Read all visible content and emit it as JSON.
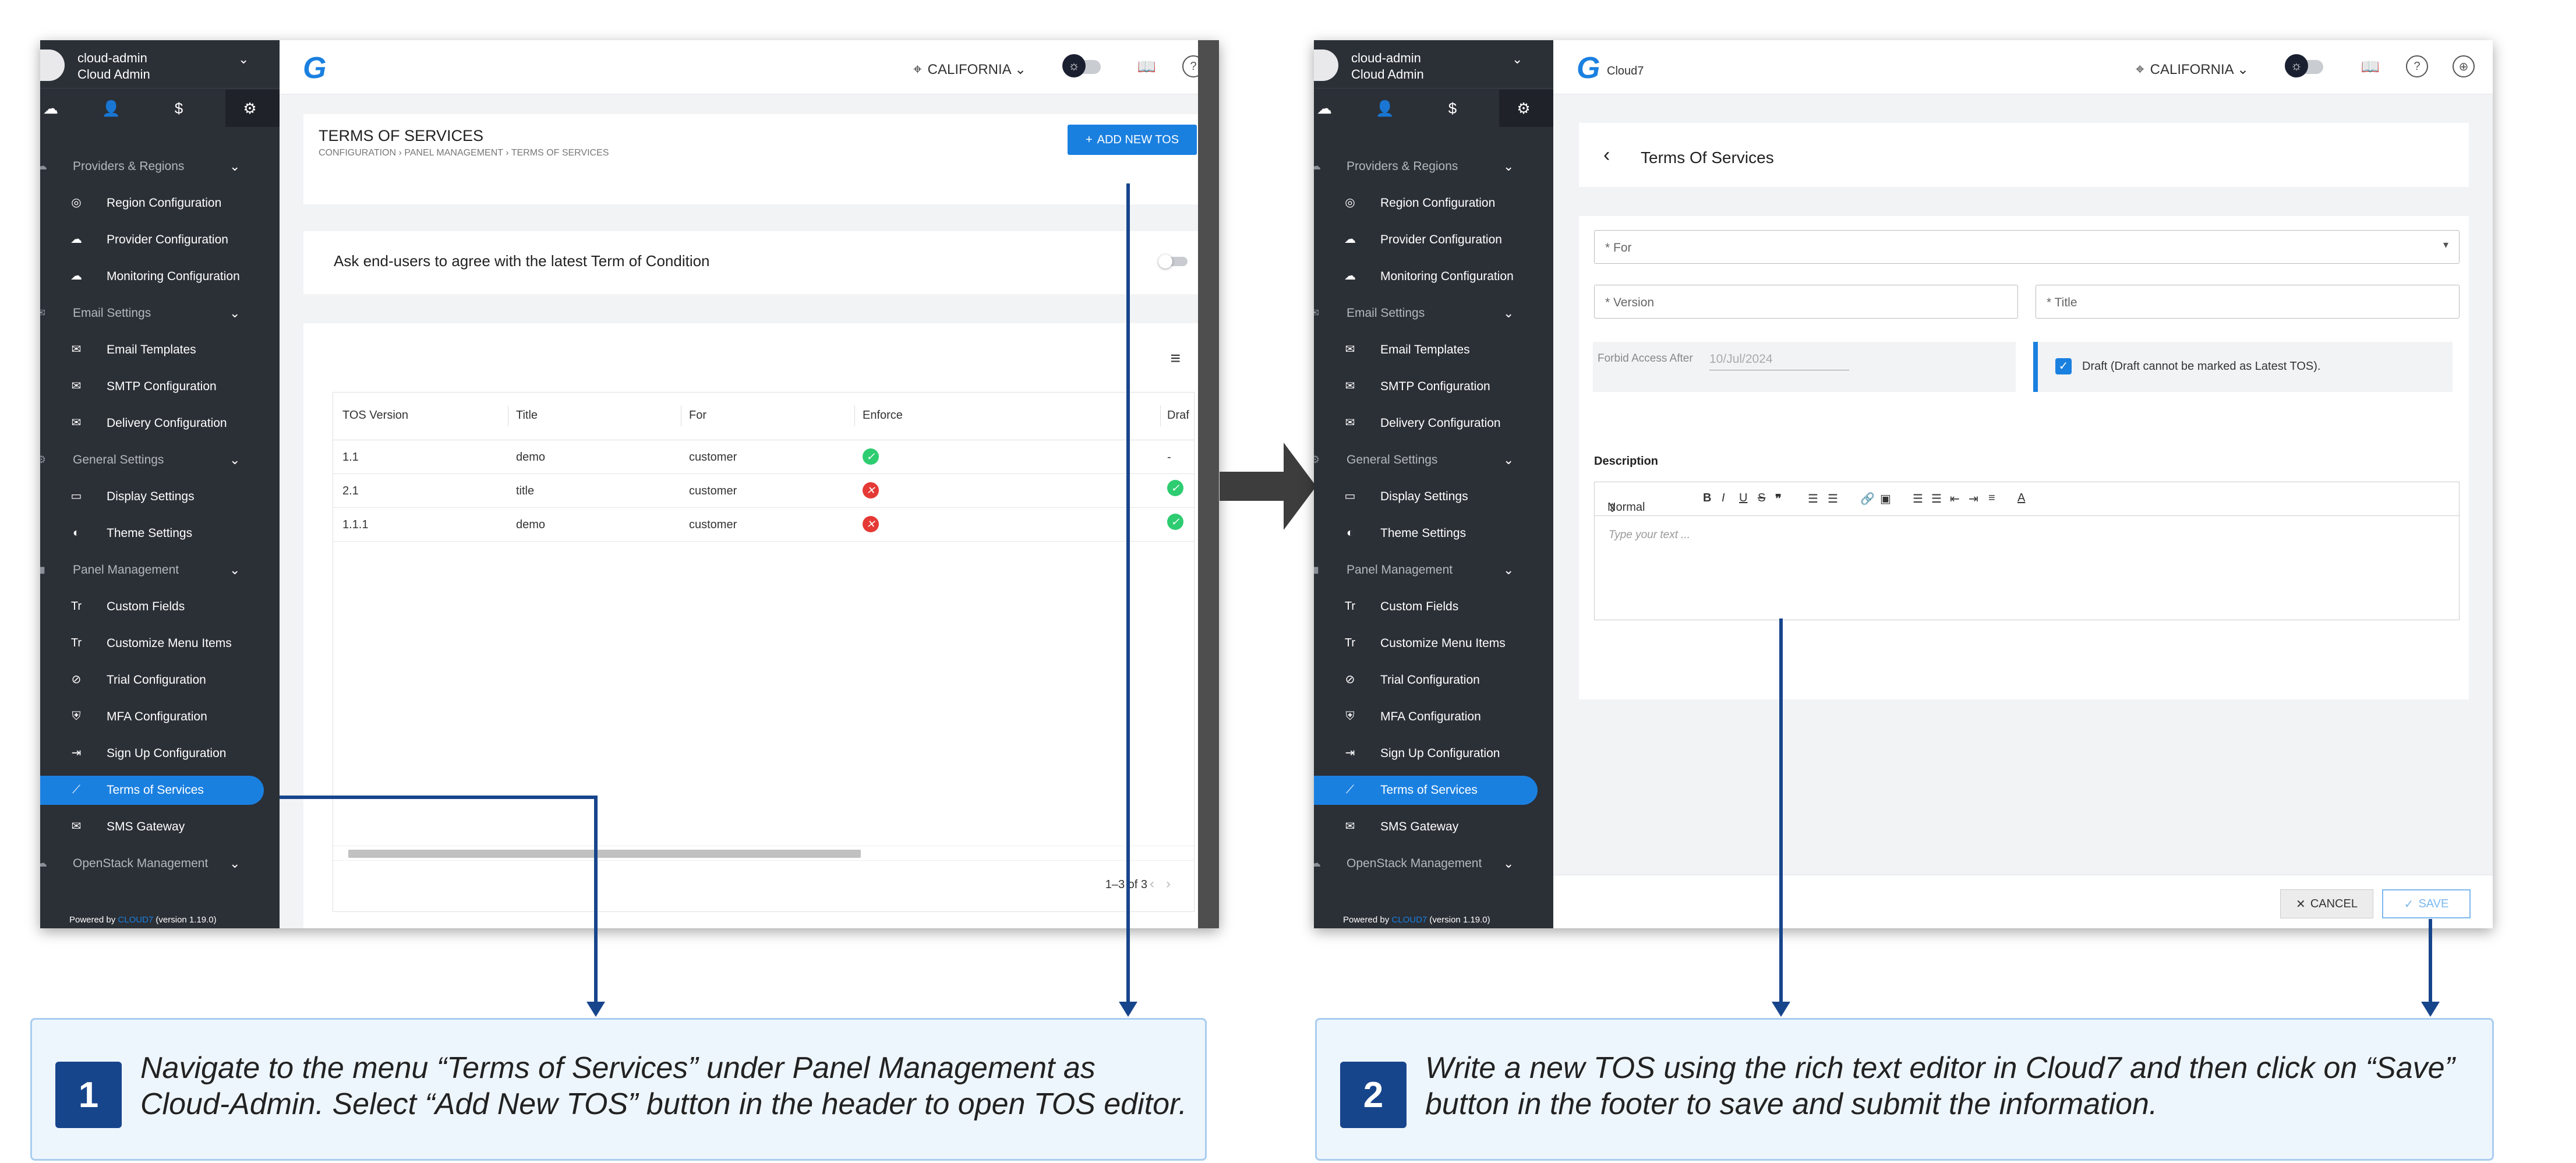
{
  "sidebar": {
    "user_name": "cloud-admin",
    "user_role": "Cloud Admin",
    "groups": [
      {
        "label": "Providers & Regions",
        "items": [
          {
            "label": "Region Configuration",
            "icon": "globe-icon"
          },
          {
            "label": "Provider Configuration",
            "icon": "cloud-icon"
          },
          {
            "label": "Monitoring Configuration",
            "icon": "cloud-upload-icon"
          }
        ]
      },
      {
        "label": "Email Settings",
        "items": [
          {
            "label": "Email Templates",
            "icon": "mail-icon"
          },
          {
            "label": "SMTP Configuration",
            "icon": "mail-settings-icon"
          },
          {
            "label": "Delivery Configuration",
            "icon": "mail-delivery-icon"
          }
        ]
      },
      {
        "label": "General Settings",
        "items": [
          {
            "label": "Display Settings",
            "icon": "monitor-icon"
          },
          {
            "label": "Theme Settings",
            "icon": "half-circle-icon"
          }
        ]
      },
      {
        "label": "Panel Management",
        "items": [
          {
            "label": "Custom Fields",
            "icon": "text-format-icon"
          },
          {
            "label": "Customize Menu Items",
            "icon": "text-format-icon"
          },
          {
            "label": "Trial Configuration",
            "icon": "trial-icon"
          },
          {
            "label": "MFA Configuration",
            "icon": "shield-check-icon"
          },
          {
            "label": "Sign Up Configuration",
            "icon": "login-icon"
          },
          {
            "label": "Terms of Services",
            "icon": "trending-icon"
          },
          {
            "label": "SMS Gateway",
            "icon": "mail-icon"
          }
        ]
      },
      {
        "label": "OpenStack Management",
        "items": []
      }
    ],
    "powered_prefix": "Powered by",
    "powered_brand": "CLOUD7",
    "powered_version": "(version 1.19.0)"
  },
  "topbar": {
    "logo_text": "Cloud7",
    "region": "CALIFORNIA"
  },
  "screen1": {
    "page_title": "TERMS OF SERVICES",
    "breadcrumb": [
      "CONFIGURATION",
      "PANEL MANAGEMENT",
      "TERMS OF SERVICES"
    ],
    "add_button": "ADD NEW TOS",
    "agree_label": "Ask end-users to agree with the latest Term of Condition",
    "columns": [
      "TOS Version",
      "Title",
      "For",
      "Enforce",
      "Draf"
    ],
    "rows": [
      {
        "version": "1.1",
        "title": "demo",
        "for": "customer",
        "enforce": true,
        "draft": "-"
      },
      {
        "version": "2.1",
        "title": "title",
        "for": "customer",
        "enforce": false,
        "draft": "check"
      },
      {
        "version": "1.1.1",
        "title": "demo",
        "for": "customer",
        "enforce": false,
        "draft": "check"
      }
    ],
    "pagination": "1–3 of 3"
  },
  "screen2": {
    "form_title": "Terms Of Services",
    "for_placeholder": "* For",
    "version_placeholder": "* Version",
    "title_placeholder": "* Title",
    "forbid_label": "Forbid Access After",
    "forbid_value": "10/Jul/2024",
    "draft_label": "Draft (Draft cannot be marked as Latest TOS).",
    "description_label": "Description",
    "editor_style": "Normal",
    "editor_placeholder": "Type your text ...",
    "cancel": "CANCEL",
    "save": "SAVE"
  },
  "callouts": [
    {
      "number": "1",
      "text": "Navigate to the menu “Terms of Services” under Panel Management as Cloud-Admin. Select “Add New TOS” button in the header to open TOS editor."
    },
    {
      "number": "2",
      "text": "Write a new TOS using the rich text editor in Cloud7 and then click on “Save” button in the footer to save and submit the information."
    }
  ],
  "colors": {
    "accent": "#1a80e0",
    "sidebar": "#2b2f36",
    "callout_blue": "#17458c"
  }
}
